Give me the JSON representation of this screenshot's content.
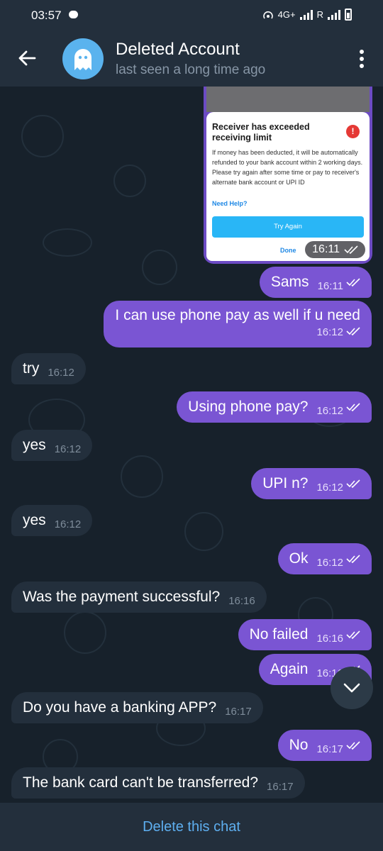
{
  "status_bar": {
    "time": "03:57",
    "network": "4G+",
    "roaming": "R"
  },
  "header": {
    "title": "Deleted Account",
    "subtitle": "last seen a long time ago"
  },
  "shared_image": {
    "dialog_title": "Receiver has exceeded receiving limit",
    "dialog_body": "If money has been deducted, it will be automatically refunded to your bank account within 2 working days. Please try again after some time or pay to receiver's alternate bank account or UPI ID",
    "help_link": "Need Help?",
    "retry_button": "Try Again",
    "done_link": "Done",
    "time": "16:11"
  },
  "messages": [
    {
      "text": "Sams",
      "time": "16:11"
    },
    {
      "text": "I can use phone pay as well if u need",
      "time": "16:12"
    },
    {
      "text": "try",
      "time": "16:12"
    },
    {
      "text": "Using phone pay?",
      "time": "16:12"
    },
    {
      "text": "yes",
      "time": "16:12"
    },
    {
      "text": "UPI n?",
      "time": "16:12"
    },
    {
      "text": "yes",
      "time": "16:12"
    },
    {
      "text": "Ok",
      "time": "16:12"
    },
    {
      "text": "Was the payment successful?",
      "time": "16:16"
    },
    {
      "text": "No failed",
      "time": "16:16"
    },
    {
      "text": "Again",
      "time": "16:16"
    },
    {
      "text": "Do you have a banking APP?",
      "time": "16:17"
    },
    {
      "text": "No",
      "time": "16:17"
    },
    {
      "text": "The bank card can't be transferred?",
      "time": "16:17"
    }
  ],
  "footer": {
    "action": "Delete this chat"
  },
  "colors": {
    "outgoing_bubble": "#7a55d3",
    "incoming_bubble": "#232f3c",
    "accent": "#5eaff0"
  }
}
